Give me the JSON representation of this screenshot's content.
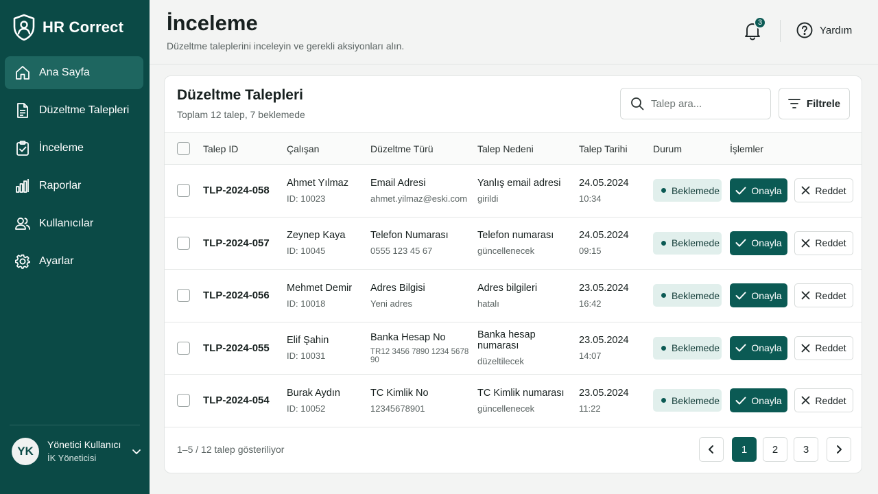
{
  "app": {
    "name": "HR Correct"
  },
  "sidebar": {
    "items": [
      {
        "label": "Ana Sayfa",
        "icon": "home-icon",
        "active": true
      },
      {
        "label": "Düzeltme Talepleri",
        "icon": "document-icon"
      },
      {
        "label": "İnceleme",
        "icon": "clipboard-check-icon"
      },
      {
        "label": "Raporlar",
        "icon": "bar-chart-icon"
      },
      {
        "label": "Kullanıcılar",
        "icon": "users-icon"
      },
      {
        "label": "Ayarlar",
        "icon": "gear-icon"
      }
    ],
    "user": {
      "initials": "YK",
      "name": "Yönetici Kullanıcı",
      "role": "İK Yöneticisi"
    }
  },
  "header": {
    "title": "İnceleme",
    "subtitle": "Düzeltme taleplerini inceleyin ve gerekli aksiyonları alın.",
    "notification_count": "3",
    "help_label": "Yardım"
  },
  "card": {
    "title": "Düzeltme Talepleri",
    "subtitle": "Toplam 12 talep, 7 beklemede",
    "search_placeholder": "Talep ara...",
    "filter_label": "Filtrele",
    "columns": [
      "Talep ID",
      "Çalışan",
      "Düzeltme Türü",
      "Talep Nedeni",
      "Talep Tarihi",
      "Durum",
      "İşlemler"
    ],
    "rows": [
      {
        "id": "TLP-2024-058",
        "employee": "Ahmet Yılmaz",
        "employee_id": "ID: 10023",
        "type": "Email Adresi",
        "type_detail": "ahmet.yilmaz@eski.com",
        "reason_1": "Yanlış email adresi",
        "reason_2": "girildi",
        "date": "24.05.2024",
        "time": "10:34",
        "status": "Beklemede",
        "approve": "Onayla",
        "reject": "Reddet"
      },
      {
        "id": "TLP-2024-057",
        "employee": "Zeynep Kaya",
        "employee_id": "ID: 10045",
        "type": "Telefon Numarası",
        "type_detail": "0555 123 45 67",
        "reason_1": "Telefon numarası",
        "reason_2": "güncellenecek",
        "date": "24.05.2024",
        "time": "09:15",
        "status": "Beklemede",
        "approve": "Onayla",
        "reject": "Reddet"
      },
      {
        "id": "TLP-2024-056",
        "employee": "Mehmet Demir",
        "employee_id": "ID: 10018",
        "type": "Adres Bilgisi",
        "type_detail": "Yeni adres",
        "reason_1": "Adres bilgileri",
        "reason_2": "hatalı",
        "date": "23.05.2024",
        "time": "16:42",
        "status": "Beklemede",
        "approve": "Onayla",
        "reject": "Reddet"
      },
      {
        "id": "TLP-2024-055",
        "employee": "Elif Şahin",
        "employee_id": "ID: 10031",
        "type": "Banka Hesap No",
        "type_detail": "TR12 3456 7890 1234 5678 90",
        "reason_1": "Banka hesap numarası",
        "reason_2": "düzeltilecek",
        "date": "23.05.2024",
        "time": "14:07",
        "status": "Beklemede",
        "approve": "Onayla",
        "reject": "Reddet"
      },
      {
        "id": "TLP-2024-054",
        "employee": "Burak Aydın",
        "employee_id": "ID: 10052",
        "type": "TC Kimlik No",
        "type_detail": "12345678901",
        "reason_1": "TC Kimlik numarası",
        "reason_2": "güncellenecek",
        "date": "23.05.2024",
        "time": "11:22",
        "status": "Beklemede",
        "approve": "Onayla",
        "reject": "Reddet"
      }
    ],
    "footer_text": "1–5 / 12 talep gösteriliyor",
    "pages": [
      "1",
      "2",
      "3"
    ],
    "active_page": "1"
  },
  "colors": {
    "sidebar_bg": "#0b4a46",
    "accent": "#0b5a54",
    "badge_bg": "#e1efec"
  }
}
